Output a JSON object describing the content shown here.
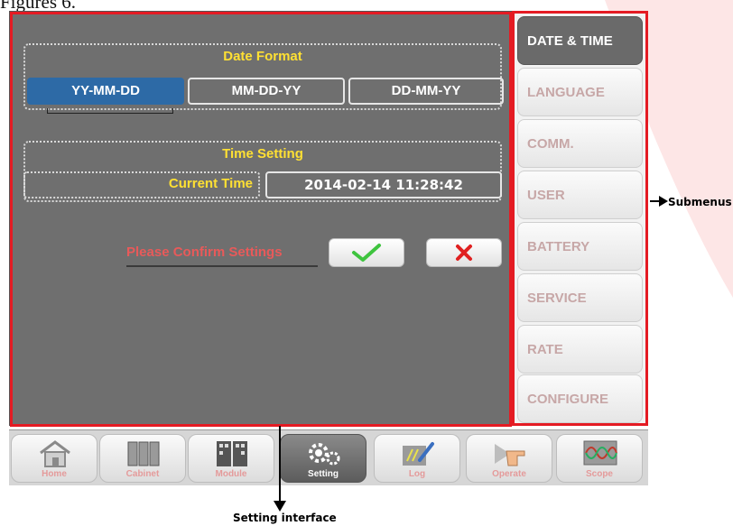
{
  "doc_header_text": "Figures 6.",
  "date_format": {
    "title": "Date Format",
    "options": [
      "YY-MM-DD",
      "MM-DD-YY",
      "DD-MM-YY"
    ],
    "selected": "YY-MM-DD"
  },
  "time_setting": {
    "title": "Time Setting",
    "label": "Current Time",
    "value": "2014-02-14  11:28:42"
  },
  "confirm": {
    "label": "Please Confirm Settings",
    "ok_icon": "check-icon",
    "cancel_icon": "x-icon"
  },
  "submenu": {
    "items": [
      "DATE & TIME",
      "LANGUAGE",
      "COMM.",
      "USER",
      "BATTERY",
      "SERVICE",
      "RATE",
      "CONFIGURE"
    ],
    "active": "DATE & TIME"
  },
  "toolbar": {
    "items": [
      {
        "label": "Home",
        "icon": "home-icon"
      },
      {
        "label": "Cabinet",
        "icon": "cabinet-icon"
      },
      {
        "label": "Module",
        "icon": "module-icon"
      },
      {
        "label": "Setting",
        "icon": "gears-icon"
      },
      {
        "label": "Log",
        "icon": "log-pen-icon"
      },
      {
        "label": "Operate",
        "icon": "hand-pointer-icon"
      },
      {
        "label": "Scope",
        "icon": "waveform-icon"
      }
    ],
    "active": "Setting"
  },
  "callouts": {
    "submenus": "Submenus",
    "setting_interface": "Setting interface"
  },
  "colors": {
    "highlight_red": "#e41b23",
    "panel_grey": "#6f6f6f",
    "title_yellow": "#ffe033",
    "selected_blue": "#2d6aa6",
    "confirm_text": "#e85a5a",
    "check_green": "#3fc43f",
    "cancel_red": "#e02020"
  }
}
